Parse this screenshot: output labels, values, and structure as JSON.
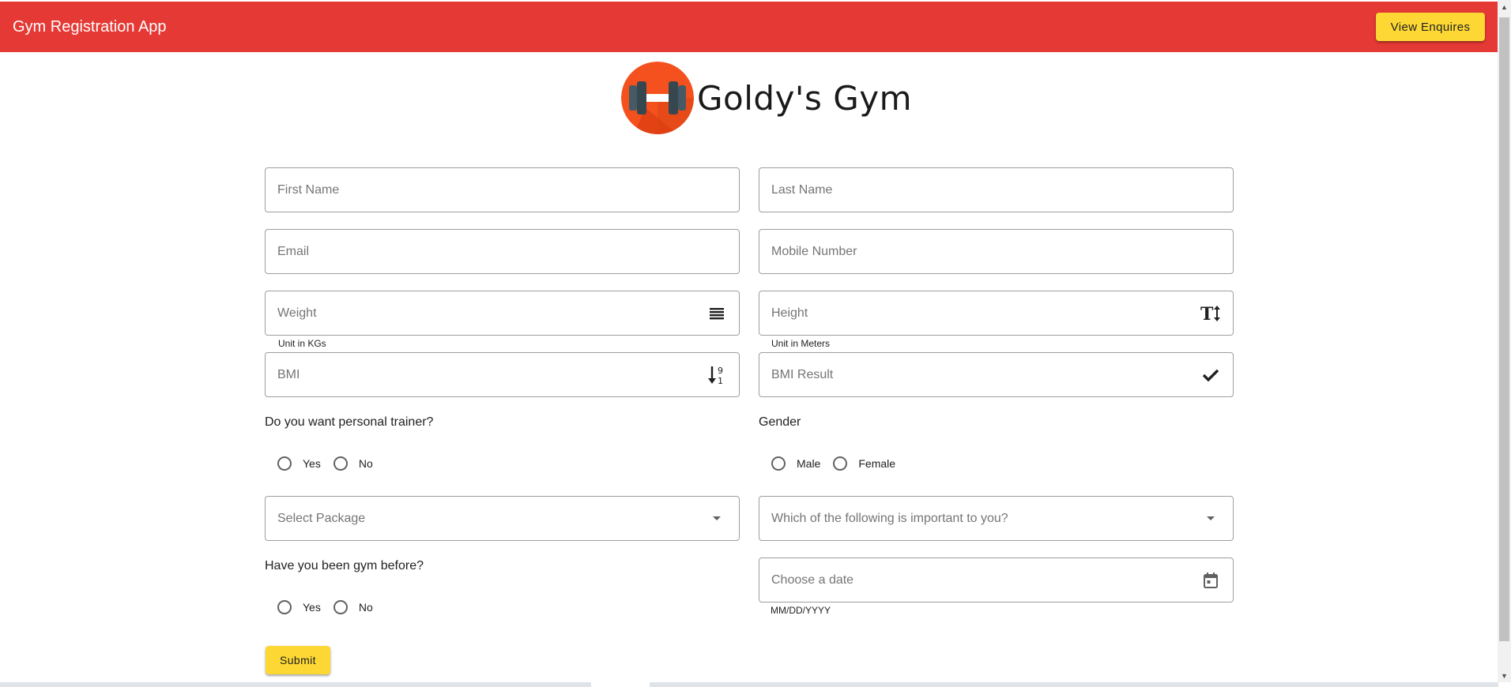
{
  "header": {
    "title": "Gym Registration App",
    "view_button_label": "View Enquires",
    "bar_color": "#e53935",
    "button_color": "#fdd835"
  },
  "logo": {
    "icon": "dumbbell-icon",
    "brand_name": "Goldy's Gym"
  },
  "form": {
    "first_name": {
      "placeholder": "First Name",
      "value": ""
    },
    "last_name": {
      "placeholder": "Last Name",
      "value": ""
    },
    "email": {
      "placeholder": "Email",
      "value": ""
    },
    "mobile": {
      "placeholder": "Mobile Number",
      "value": ""
    },
    "weight": {
      "placeholder": "Weight",
      "value": "",
      "hint": "Unit in KGs",
      "icon": "list-icon"
    },
    "height": {
      "placeholder": "Height",
      "value": "",
      "hint": "Unit in Meters",
      "icon": "text-height-icon"
    },
    "bmi": {
      "placeholder": "BMI",
      "value": "",
      "icon": "sort-numeric-icon"
    },
    "bmi_result": {
      "placeholder": "BMI Result",
      "value": "",
      "icon": "check-icon"
    },
    "trainer": {
      "question": "Do you want personal trainer?",
      "options": [
        "Yes",
        "No"
      ]
    },
    "gender": {
      "question": "Gender",
      "options": [
        "Male",
        "Female"
      ]
    },
    "package": {
      "placeholder": "Select Package",
      "icon": "dropdown-arrow-icon"
    },
    "important": {
      "placeholder": "Which of the following is important to you?",
      "icon": "dropdown-arrow-icon"
    },
    "gym_before": {
      "question": "Have you been gym before?",
      "options": [
        "Yes",
        "No"
      ]
    },
    "date": {
      "placeholder": "Choose a date",
      "value": "",
      "hint": "MM/DD/YYYY",
      "icon": "calendar-icon"
    },
    "submit_label": "Submit"
  }
}
